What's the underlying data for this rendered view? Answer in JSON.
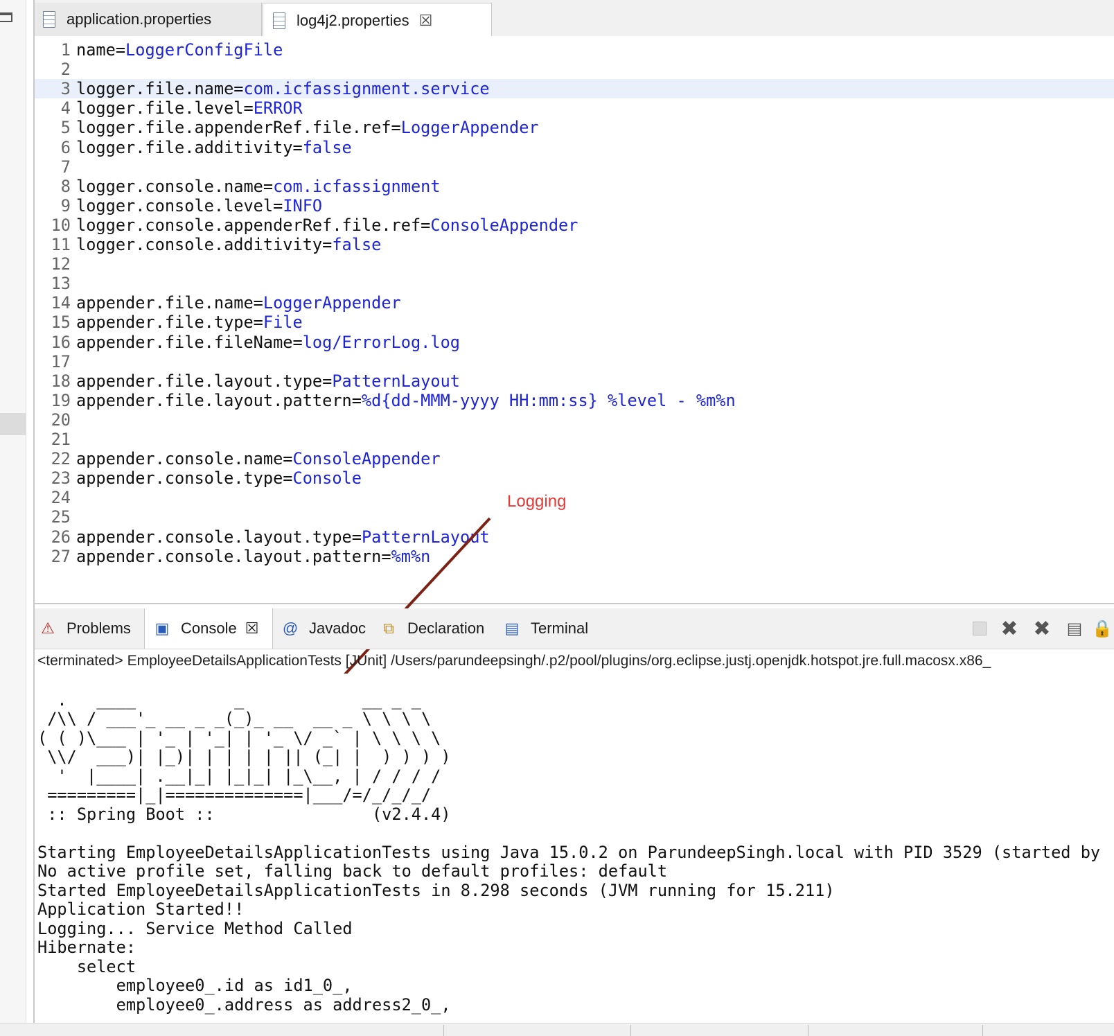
{
  "editor": {
    "tabs": [
      {
        "label": "application.properties",
        "active": false
      },
      {
        "label": "log4j2.properties",
        "active": true
      }
    ],
    "highlighted_line": 3,
    "lines": [
      {
        "n": "1",
        "key": "name=",
        "val": "LoggerConfigFile"
      },
      {
        "n": "2",
        "key": "",
        "val": ""
      },
      {
        "n": "3",
        "key": "logger.file.name=",
        "val": "com.icfassignment.service"
      },
      {
        "n": "4",
        "key": "logger.file.level=",
        "val": "ERROR"
      },
      {
        "n": "5",
        "key": "logger.file.appenderRef.file.ref=",
        "val": "LoggerAppender"
      },
      {
        "n": "6",
        "key": "logger.file.additivity=",
        "val": "false"
      },
      {
        "n": "7",
        "key": "",
        "val": ""
      },
      {
        "n": "8",
        "key": "logger.console.name=",
        "val": "com.icfassignment"
      },
      {
        "n": "9",
        "key": "logger.console.level=",
        "val": "INFO"
      },
      {
        "n": "10",
        "key": "logger.console.appenderRef.file.ref=",
        "val": "ConsoleAppender"
      },
      {
        "n": "11",
        "key": "logger.console.additivity=",
        "val": "false"
      },
      {
        "n": "12",
        "key": "",
        "val": ""
      },
      {
        "n": "13",
        "key": "",
        "val": ""
      },
      {
        "n": "14",
        "key": "appender.file.name=",
        "val": "LoggerAppender"
      },
      {
        "n": "15",
        "key": "appender.file.type=",
        "val": "File"
      },
      {
        "n": "16",
        "key": "appender.file.fileName=",
        "val": "log/ErrorLog.log"
      },
      {
        "n": "17",
        "key": "",
        "val": ""
      },
      {
        "n": "18",
        "key": "appender.file.layout.type=",
        "val": "PatternLayout"
      },
      {
        "n": "19",
        "key": "appender.file.layout.pattern=",
        "val": "%d{dd-MMM-yyyy HH:mm:ss} %level - %m%n"
      },
      {
        "n": "20",
        "key": "",
        "val": ""
      },
      {
        "n": "21",
        "key": "",
        "val": ""
      },
      {
        "n": "22",
        "key": "appender.console.name=",
        "val": "ConsoleAppender"
      },
      {
        "n": "23",
        "key": "appender.console.type=",
        "val": "Console"
      },
      {
        "n": "24",
        "key": "",
        "val": ""
      },
      {
        "n": "25",
        "key": "",
        "val": ""
      },
      {
        "n": "26",
        "key": "appender.console.layout.type=",
        "val": "PatternLayout"
      },
      {
        "n": "27",
        "key": "appender.console.layout.pattern=",
        "val": "%m%n"
      }
    ]
  },
  "annotation": {
    "label": "Logging",
    "color": "#e53935",
    "arrow_color": "#7b2215"
  },
  "panel": {
    "tabs": [
      {
        "label": "Problems",
        "icon": "problems-icon"
      },
      {
        "label": "Console",
        "icon": "console-icon",
        "active": true
      },
      {
        "label": "Javadoc",
        "icon": "javadoc-icon"
      },
      {
        "label": "Declaration",
        "icon": "declaration-icon"
      },
      {
        "label": "Terminal",
        "icon": "terminal-icon"
      }
    ],
    "toolbar": [
      "stop-icon",
      "remove-launch-icon",
      "remove-all-launches-icon",
      "clear-console-icon",
      "scroll-lock-icon"
    ],
    "header": "<terminated> EmployeeDetailsApplicationTests [JUnit] /Users/parundeepsingh/.p2/pool/plugins/org.eclipse.justj.openjdk.hotspot.jre.full.macosx.x86_",
    "console_lines": [
      "",
      "  .   ____          _            __ _ _",
      " /\\\\ / ___'_ __ _ _(_)_ __  __ _ \\ \\ \\ \\",
      "( ( )\\___ | '_ | '_| | '_ \\/ _` | \\ \\ \\ \\",
      " \\\\/  ___)| |_)| | | | | || (_| |  ) ) ) )",
      "  '  |____| .__|_| |_|_| |_\\__, | / / / /",
      " =========|_|==============|___/=/_/_/_/",
      " :: Spring Boot ::                (v2.4.4)",
      "",
      "Starting EmployeeDetailsApplicationTests using Java 15.0.2 on ParundeepSingh.local with PID 3529 (started by",
      "No active profile set, falling back to default profiles: default",
      "Started EmployeeDetailsApplicationTests in 8.298 seconds (JVM running for 15.211)",
      "Application Started!!",
      "Logging... Service Method Called",
      "Hibernate:",
      "    select",
      "        employee0_.id as id1_0_,",
      "        employee0_.address as address2_0_,"
    ]
  }
}
